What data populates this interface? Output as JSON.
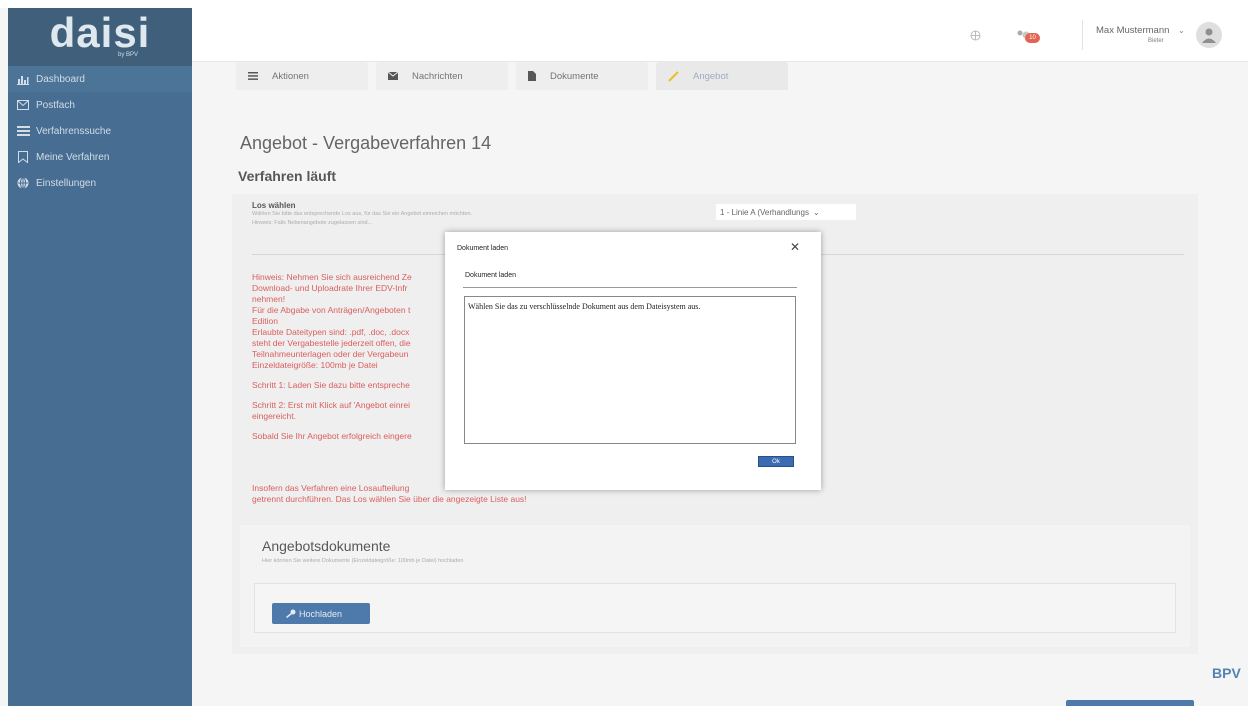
{
  "brand": {
    "logo": "daisi",
    "logo_sub": "by BPV",
    "footer_logo": "BPV"
  },
  "sidebar": {
    "items": [
      {
        "label": "Dashboard",
        "icon": "bar-chart-icon"
      },
      {
        "label": "Postfach",
        "icon": "envelope-icon"
      },
      {
        "label": "Verfahrenssuche",
        "icon": "list-icon"
      },
      {
        "label": "Meine Verfahren",
        "icon": "bookmark-icon"
      },
      {
        "label": "Einstellungen",
        "icon": "globe-icon"
      }
    ]
  },
  "header": {
    "notification_count": "10",
    "user_name": "Max Mustermann",
    "user_role": "Bieter"
  },
  "tabs": [
    {
      "label": "Aktionen",
      "icon": "list-icon"
    },
    {
      "label": "Nachrichten",
      "icon": "envelope-icon"
    },
    {
      "label": "Dokumente",
      "icon": "document-icon"
    },
    {
      "label": "Angebot",
      "icon": "pencil-icon"
    }
  ],
  "page": {
    "title": "Angebot - Vergabeverfahren 14",
    "status": "Verfahren läuft"
  },
  "los": {
    "label": "Los wählen",
    "help1": "Wählen Sie bitte das entsprechende Los aus, für das Sie ein Angebot einreichen möchten.",
    "help2": "Hinweis: Falls Nebenangebote zugelassen sind...",
    "selected": "1 - Linie A (Verhandlungs"
  },
  "notice": {
    "lines": [
      "Hinweis: Nehmen Sie sich ausreichend Ze",
      "Download- und Uploadrate Ihrer EDV-Infr",
      "nehmen!",
      "Für die Abgabe von Anträgen/Angeboten t",
      "Edition",
      "Erlaubte Dateitypen sind: .pdf, .doc, .docx",
      "steht der Vergabestelle jederzeit offen, die",
      "Teilnahmeunterlagen oder der Vergabeun",
      "Einzeldateigröße: 100mb je Datei"
    ],
    "step1": "Schritt 1: Laden Sie dazu bitte entspreche",
    "step2a": "Schritt 2: Erst mit Klick auf 'Angebot einrei",
    "step2b": "eingereicht.",
    "final1": "Sobald Sie Ihr Angebot erfolgreich eingere",
    "final2": "Insofern das Verfahren eine Losaufteilung",
    "final3": "getrennt durchführen. Das Los wählen Sie über die angezeigte Liste aus!"
  },
  "docs": {
    "title": "Angebotsdokumente",
    "help": "Hier können Sie weitere Dokumente (Einzeldateigröße: 100mb je Datei) hochladen",
    "upload_label": "Hochladen"
  },
  "dialog": {
    "title": "Dokument laden",
    "label": "Dokument laden",
    "message": "Wählen Sie das zu verschlüsselnde Dokument aus dem Dateisystem aus.",
    "ok_label": "Ok"
  },
  "colors": {
    "sidebar": "#1f4e7a",
    "accent": "#275c99",
    "notice": "#d23a3a"
  }
}
